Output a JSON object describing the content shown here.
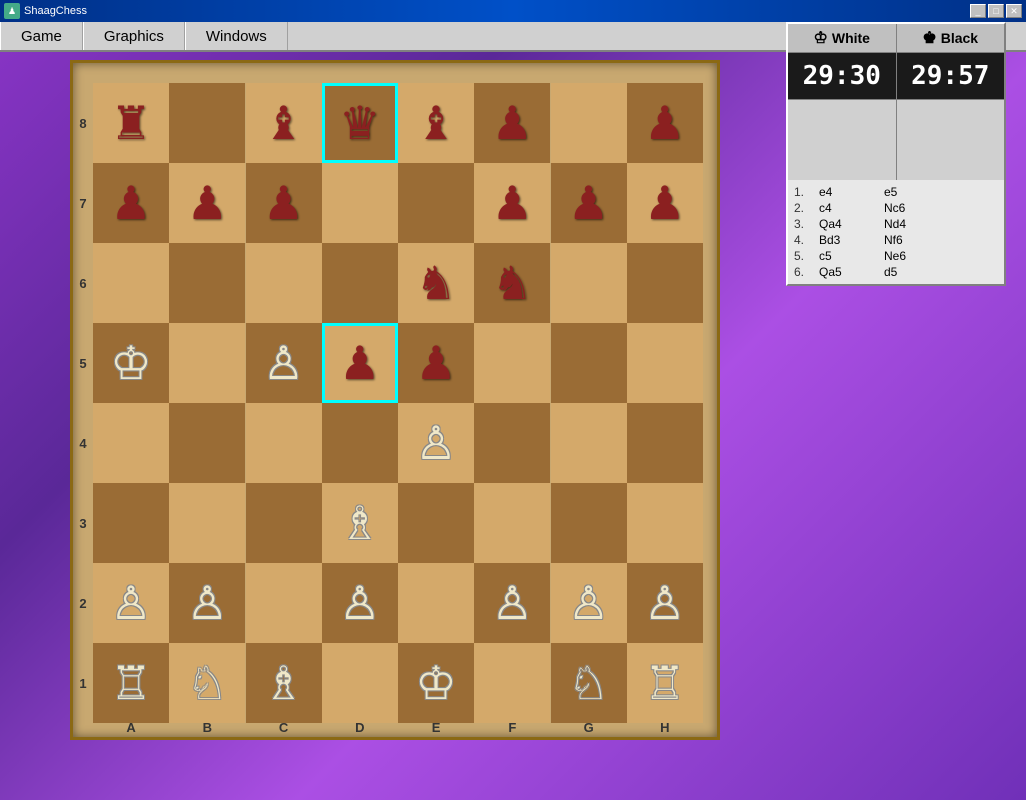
{
  "window": {
    "title": "ShaagChess",
    "title_icon": "♟"
  },
  "titlebar_buttons": {
    "minimize": "_",
    "maximize": "□",
    "close": "✕"
  },
  "menu": {
    "items": [
      "Game",
      "Graphics",
      "Windows"
    ]
  },
  "panel": {
    "white_label": "White",
    "black_label": "Black",
    "white_icon": "♔",
    "black_icon": "♚",
    "white_timer": "29:30",
    "black_timer": "29:57"
  },
  "moves": [
    {
      "num": "1.",
      "white": "e4",
      "black": "e5"
    },
    {
      "num": "2.",
      "white": "c4",
      "black": "Nc6"
    },
    {
      "num": "3.",
      "white": "Qa4",
      "black": "Nd4"
    },
    {
      "num": "4.",
      "white": "Bd3",
      "black": "Nf6"
    },
    {
      "num": "5.",
      "white": "c5",
      "black": "Ne6"
    },
    {
      "num": "6.",
      "white": "Qa5",
      "black": "d5"
    }
  ],
  "col_labels": [
    "A",
    "B",
    "C",
    "D",
    "E",
    "F",
    "G",
    "H"
  ],
  "row_labels": [
    "8",
    "7",
    "6",
    "5",
    "4",
    "3",
    "2",
    "1"
  ]
}
